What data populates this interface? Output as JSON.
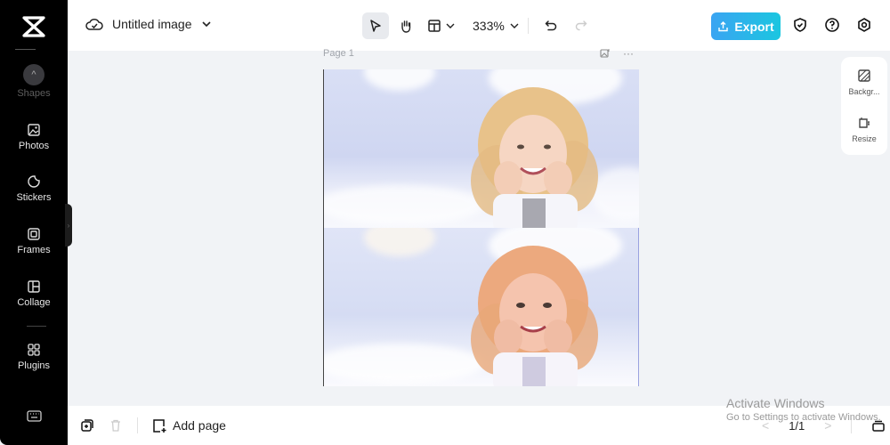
{
  "app": {
    "document_title": "Untitled image",
    "zoom_level": "333%",
    "export_label": "Export",
    "brand_color": "#1bc6e0"
  },
  "sidebar": {
    "items": [
      {
        "label": "Shapes",
        "icon": "chevron-up-icon"
      },
      {
        "label": "Photos",
        "icon": "photo-icon"
      },
      {
        "label": "Stickers",
        "icon": "sticker-icon"
      },
      {
        "label": "Frames",
        "icon": "frame-icon"
      },
      {
        "label": "Collage",
        "icon": "collage-icon"
      },
      {
        "label": "Plugins",
        "icon": "plugins-icon"
      }
    ],
    "bottom_icon": "keyboard-icon"
  },
  "canvas": {
    "page_label": "Page 1",
    "more_label": "···"
  },
  "right_panel": {
    "items": [
      {
        "label": "Backgr...",
        "icon": "background-icon"
      },
      {
        "label": "Resize",
        "icon": "resize-icon"
      }
    ]
  },
  "bottom": {
    "add_page_label": "Add page",
    "pager_text": "1/1",
    "prev": "<",
    "next": ">"
  },
  "watermark": {
    "line1": "Activate Windows",
    "line2": "Go to Settings to activate Windows."
  }
}
